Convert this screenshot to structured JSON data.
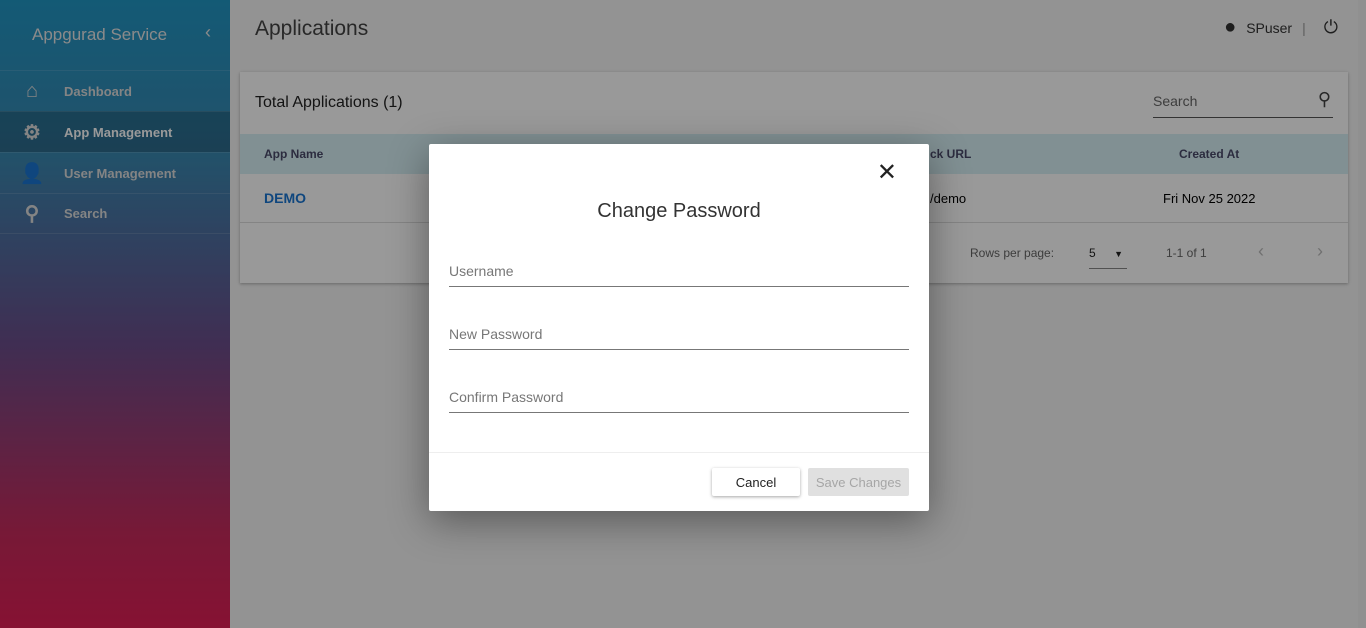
{
  "sidebar": {
    "brand": "Appgurad Service",
    "items": [
      {
        "label": "Dashboard",
        "icon": "home-icon"
      },
      {
        "label": "App Management",
        "icon": "box-gear-icon"
      },
      {
        "label": "User Management",
        "icon": "user-gear-icon"
      },
      {
        "label": "Search",
        "icon": "search-icon"
      }
    ]
  },
  "header": {
    "title": "Applications",
    "user": "SPuser",
    "separator": "|"
  },
  "card": {
    "title": "Total Applications (1)",
    "search_placeholder": "Search",
    "columns": [
      "App Name",
      "ck URL",
      "Created At"
    ],
    "rows": [
      {
        "name": "DEMO",
        "url": "/demo",
        "created": "Fri Nov 25 2022"
      }
    ],
    "pager": {
      "rows_label": "Rows per page:",
      "rows_value": "5",
      "range": "1-1 of 1"
    }
  },
  "dialog": {
    "title": "Change Password",
    "close": "✕",
    "fields": [
      {
        "placeholder": "Username"
      },
      {
        "placeholder": "New Password"
      },
      {
        "placeholder": "Confirm Password"
      }
    ],
    "cancel": "Cancel",
    "save": "Save Changes"
  }
}
